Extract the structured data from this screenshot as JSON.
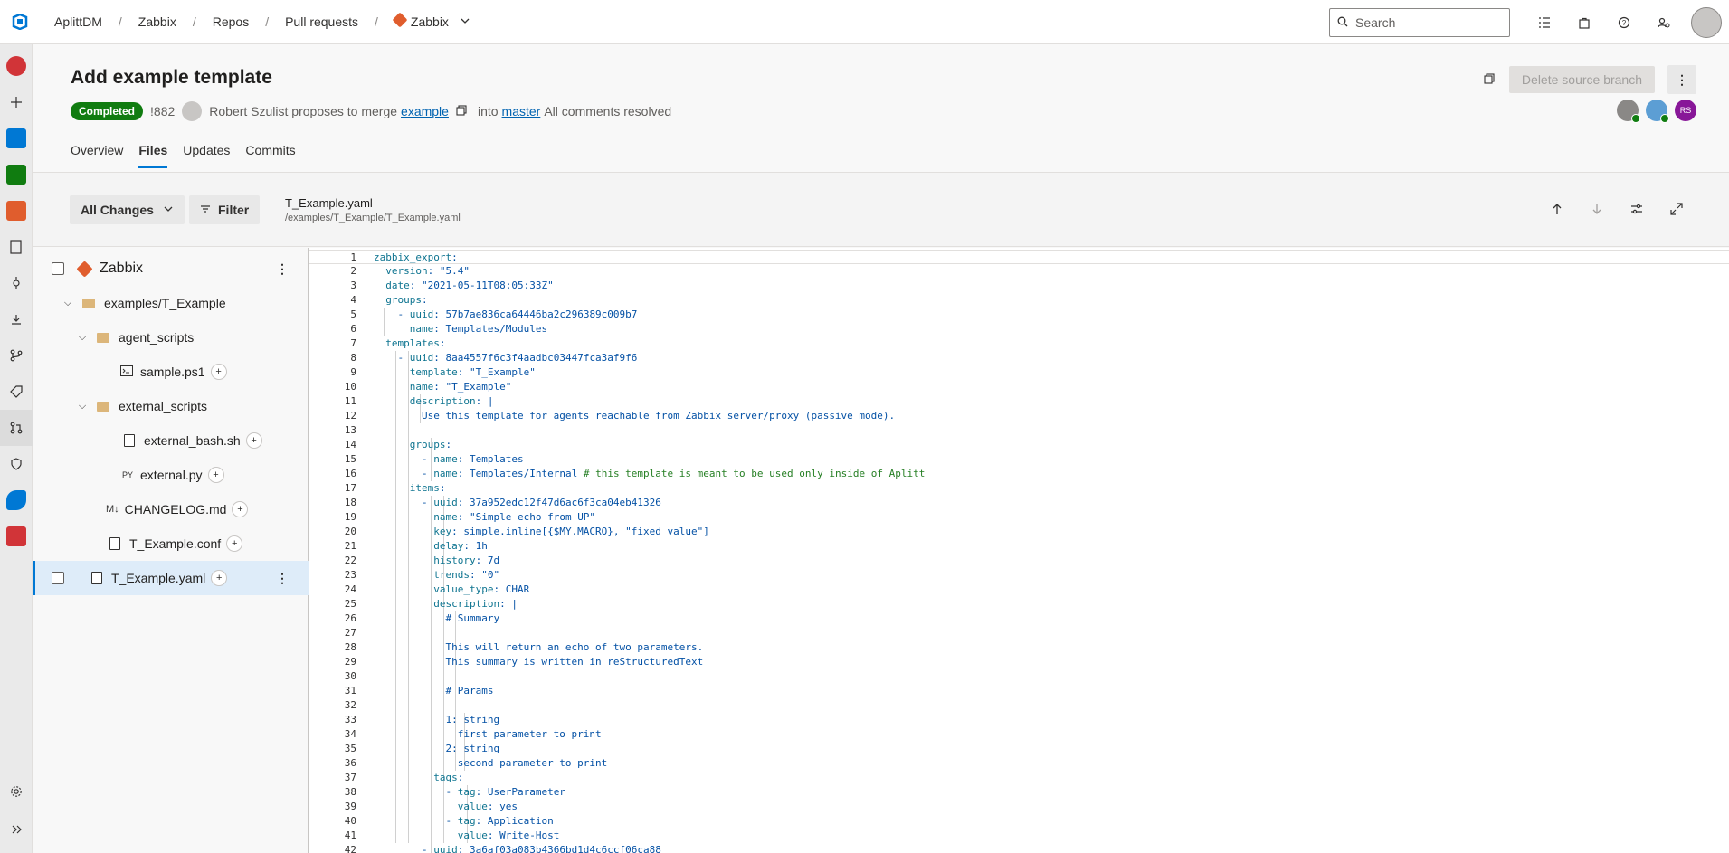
{
  "topbar": {
    "breadcrumbs": [
      "AplittDM",
      "Zabbix",
      "Repos",
      "Pull requests",
      "Zabbix"
    ],
    "search_placeholder": "Search"
  },
  "pr": {
    "title": "Add example template",
    "status": "Completed",
    "id": "!882",
    "author_text": "Robert Szulist proposes to merge",
    "source_branch": "example",
    "into_text": "into",
    "target_branch": "master",
    "comments_text": "All comments resolved",
    "delete_button": "Delete source branch",
    "reviewer_initials": "RS"
  },
  "tabs": [
    "Overview",
    "Files",
    "Updates",
    "Commits"
  ],
  "toolbar": {
    "changes_label": "All Changes",
    "filter_label": "Filter",
    "file_name": "T_Example.yaml",
    "file_path": "/examples/T_Example/T_Example.yaml"
  },
  "tree": {
    "root": "Zabbix",
    "folder1": "examples/T_Example",
    "folder2": "agent_scripts",
    "file1": "sample.ps1",
    "folder3": "external_scripts",
    "file2": "external_bash.sh",
    "file3": "external.py",
    "file4": "CHANGELOG.md",
    "file5": "T_Example.conf",
    "file6": "T_Example.yaml",
    "py_label": "PY",
    "md_label": "M↓"
  },
  "code": {
    "l1": "zabbix_export:",
    "l2": "  version: \"5.4\"",
    "l3": "  date: \"2021-05-11T08:05:33Z\"",
    "l4": "  groups:",
    "l5": "    - uuid: 57b7ae836ca64446ba2c296389c009b7",
    "l6": "      name: Templates/Modules",
    "l7": "  templates:",
    "l8": "    - uuid: 8aa4557f6c3f4aadbc03447fca3af9f6",
    "l9": "      template: \"T_Example\"",
    "l10": "      name: \"T_Example\"",
    "l11": "      description: |",
    "l12": "        Use this template for agents reachable from Zabbix server/proxy (passive mode).",
    "l13": "",
    "l14": "      groups:",
    "l15": "        - name: Templates",
    "l16": "        - name: Templates/Internal # this template is meant to be used only inside of Aplitt",
    "l17": "      items:",
    "l18": "        - uuid: 37a952edc12f47d6ac6f3ca04eb41326",
    "l19": "          name: \"Simple echo from UP\"",
    "l20": "          key: simple.inline[{$MY.MACRO}, \"fixed value\"]",
    "l21": "          delay: 1h",
    "l22": "          history: 7d",
    "l23": "          trends: \"0\"",
    "l24": "          value_type: CHAR",
    "l25": "          description: |",
    "l26": "            # Summary",
    "l27": "",
    "l28": "            This will return an echo of two parameters.",
    "l29": "            This summary is written in reStructuredText",
    "l30": "",
    "l31": "            # Params",
    "l32": "",
    "l33": "            1: string",
    "l34": "              first parameter to print",
    "l35": "            2: string",
    "l36": "              second parameter to print",
    "l37": "          tags:",
    "l38": "            - tag: UserParameter",
    "l39": "              value: yes",
    "l40": "            - tag: Application",
    "l41": "              value: Write-Host",
    "l42": "        - uuid: 3a6af03a083b4366bd1d4c6ccf06ca88"
  },
  "colors": {
    "accent": "#0078d4",
    "completed": "#107c10",
    "code_blue": "#0451a5",
    "code_key": "#0e7490",
    "code_comment": "#267f24"
  }
}
